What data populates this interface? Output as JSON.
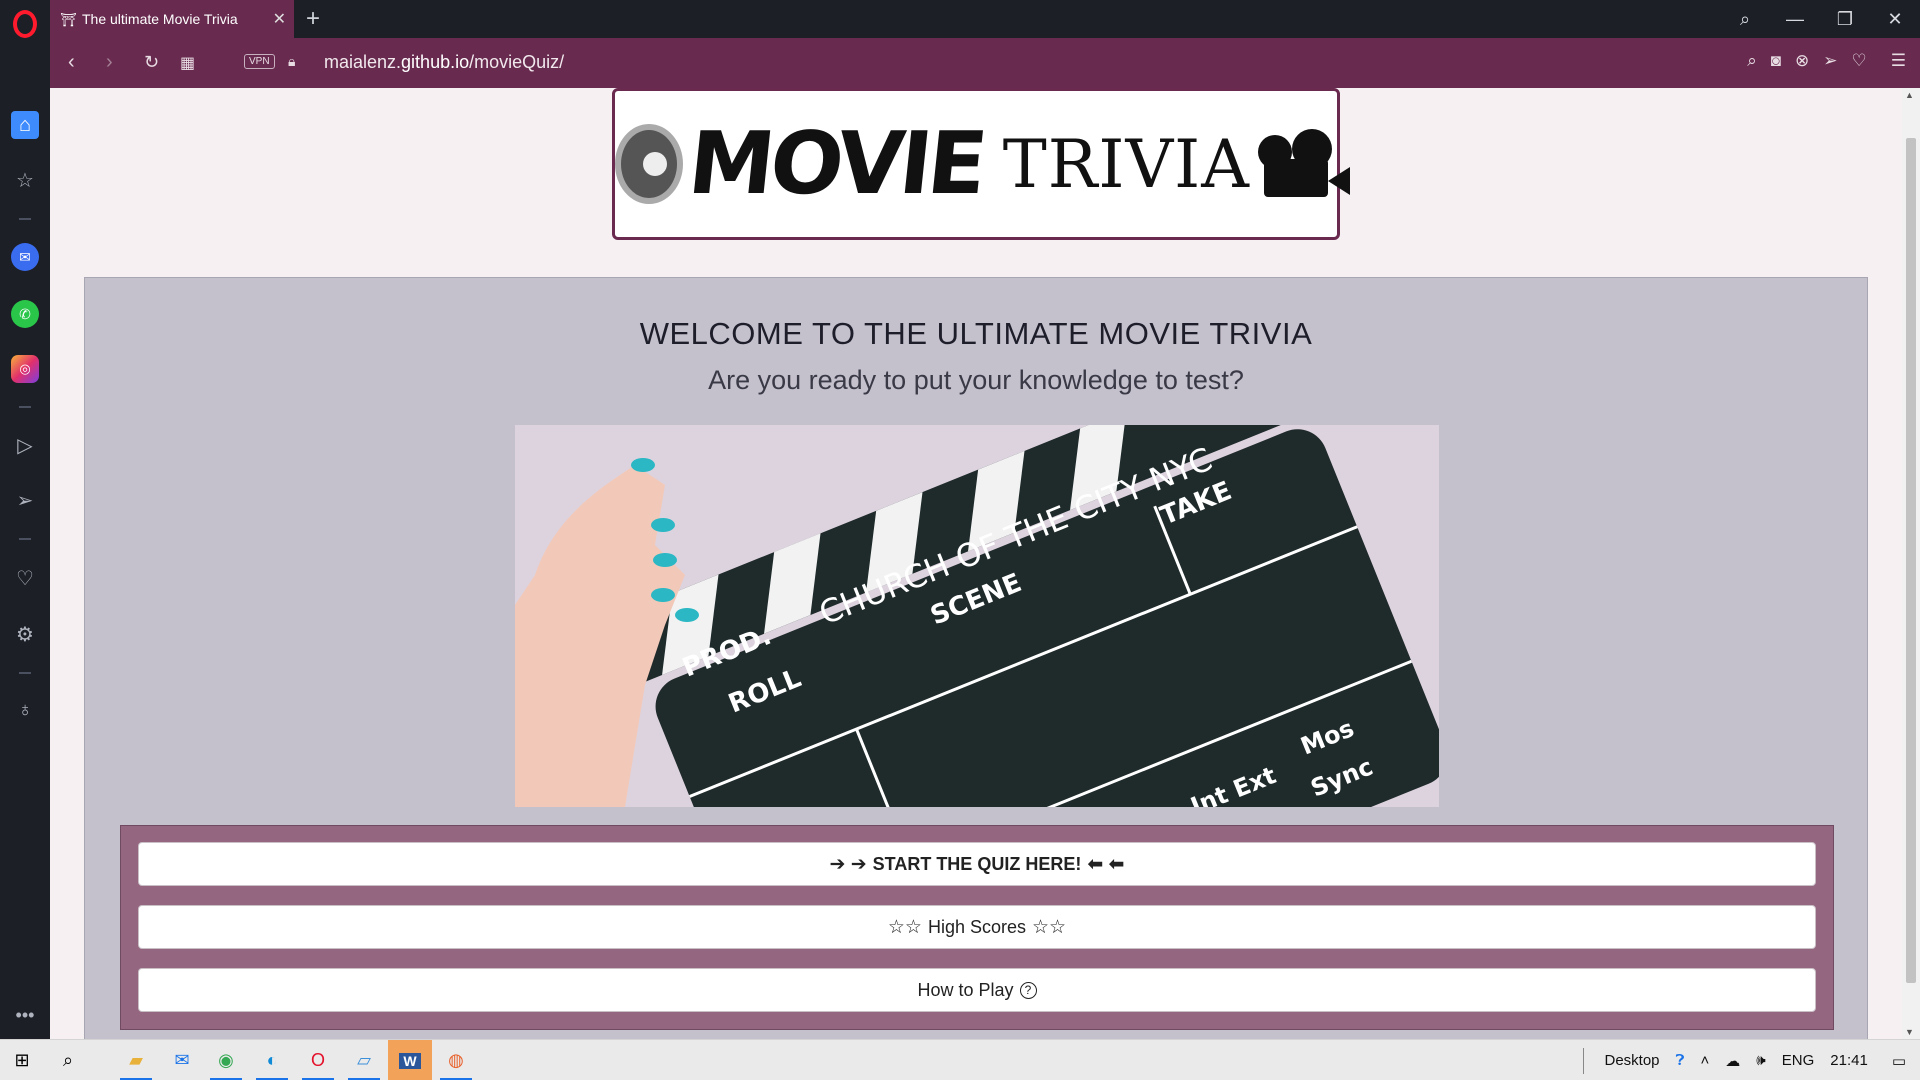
{
  "browser": {
    "tab_title": "The ultimate Movie Trivia",
    "tab_close": "✕",
    "new_tab": "+",
    "url_prefix": "maialenz.",
    "url_domain": "github.io",
    "url_path": "/movieQuiz/",
    "vpn_label": "VPN",
    "window_controls": [
      "⌕",
      "—",
      "❐",
      "✕"
    ],
    "accent_color": "#682b4f"
  },
  "sidebar": {
    "items": [
      "home-icon",
      "star-icon",
      "messenger-icon",
      "whatsapp-icon",
      "instagram-icon",
      "player-icon",
      "send-icon",
      "heart-icon",
      "settings-icon",
      "bulb-icon"
    ],
    "more": "•••"
  },
  "page": {
    "logo_movie": "MOVIE",
    "logo_trivia": "TRIVIA",
    "title": "WELCOME TO THE ULTIMATE MOVIE TRIVIA",
    "subtitle": "Are you ready to put your knowledge to test?",
    "clapper": {
      "church": "CHURCH OF THE CITY NYC",
      "prod": "PROD.",
      "roll": "ROLL",
      "scene": "SCENE",
      "take": "TAKE",
      "int_ext": "Int Ext",
      "mos": "Mos",
      "sync": "Sync"
    },
    "buttons": {
      "start": "START THE QUIZ HERE!",
      "start_icons_left": "➔ ➔",
      "start_icons_right": "⬅ ⬅",
      "high_scores": "High Scores",
      "high_icons": "☆☆",
      "how_to_play": "How to Play",
      "how_icon": "?"
    }
  },
  "taskbar": {
    "desktop_label": "Desktop",
    "lang": "ENG",
    "time": "21:41",
    "apps": [
      "windows-start-icon",
      "search-icon",
      "file-explorer-icon",
      "mail-icon",
      "chrome-icon",
      "edge-icon",
      "opera-icon",
      "photos-icon",
      "word-icon",
      "firefox-icon"
    ]
  }
}
